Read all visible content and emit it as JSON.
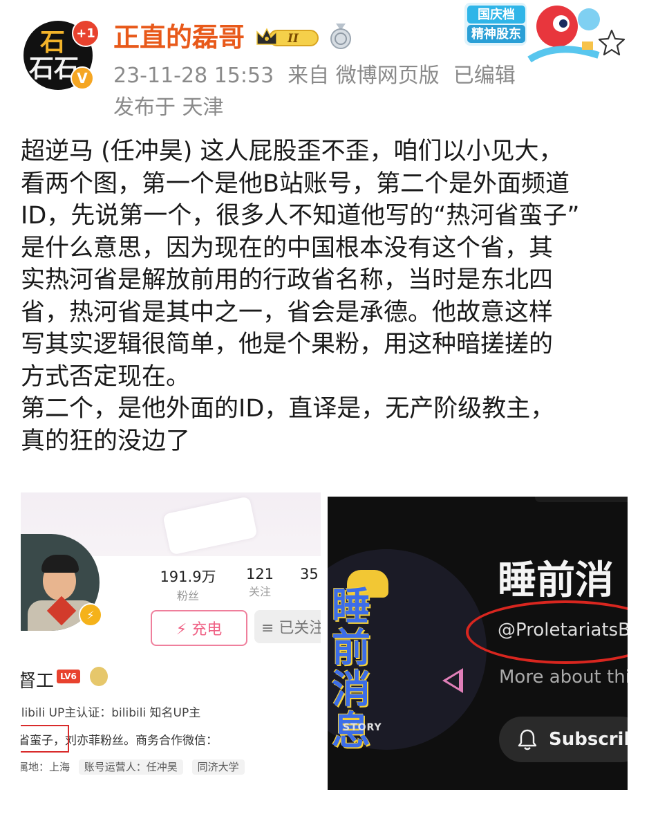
{
  "header": {
    "avatar_glyph_top": "石",
    "avatar_glyph_bottom": "石石",
    "plus_badge": "+1",
    "verified_badge": "V",
    "username": "正直的磊哥",
    "crown_level": "II",
    "timestamp": "23-11-28 15:53",
    "source": "来自 微博网页版",
    "edited": "已编辑",
    "location": "发布于 天津",
    "promo_line1": "国庆档",
    "promo_line2": "精神股东"
  },
  "post": {
    "text": "超逆马 (任冲昊) 这人屁股歪不歪，咱们以小见大，\n看两个图，第一个是他B站账号，第二个是外面频道\nID，先说第一个，很多人不知道他写的“热河省蛮子”\n是什么意思，因为现在的中国根本没有这个省，其\n实热河省是解放前用的行政省名称，当时是东北四\n省，热河省是其中之一，省会是承德。他故意这样\n写其实逻辑很简单，他是个果粉，用这种暗搓搓的\n方式否定现在。\n第二个，是他外面的ID，直译是，无产阶级教主，\n真的狂的没边了"
  },
  "image1": {
    "stats": [
      {
        "num": "191.9万",
        "label": "粉丝"
      },
      {
        "num": "121",
        "label": "关注"
      },
      {
        "num": "35",
        "label": ""
      }
    ],
    "charge_button": "⚡ 充电",
    "followed_button": "≡ 已关注",
    "name_partial": "督工",
    "level": "LV6",
    "verify": "ilibili UP主认证：bilibili 知名UP主",
    "bio_boxed": "省蛮子，",
    "bio_rest": "刘亦菲粉丝。商务合作微信：",
    "tags_location": "属地：上海",
    "tags_operator": "账号运营人：任冲昊",
    "tags_school": "同济大学"
  },
  "image2": {
    "logo_text": "睡前消息",
    "logo_story": "STORY",
    "channel_title": "睡前消",
    "handle": "@ProletariatsB",
    "more_about": "More about this",
    "subscribe": "Subscrib"
  },
  "colors": {
    "username": "#e8591a",
    "meta": "#8a8a8a",
    "highlight_red": "#d92b2b"
  }
}
